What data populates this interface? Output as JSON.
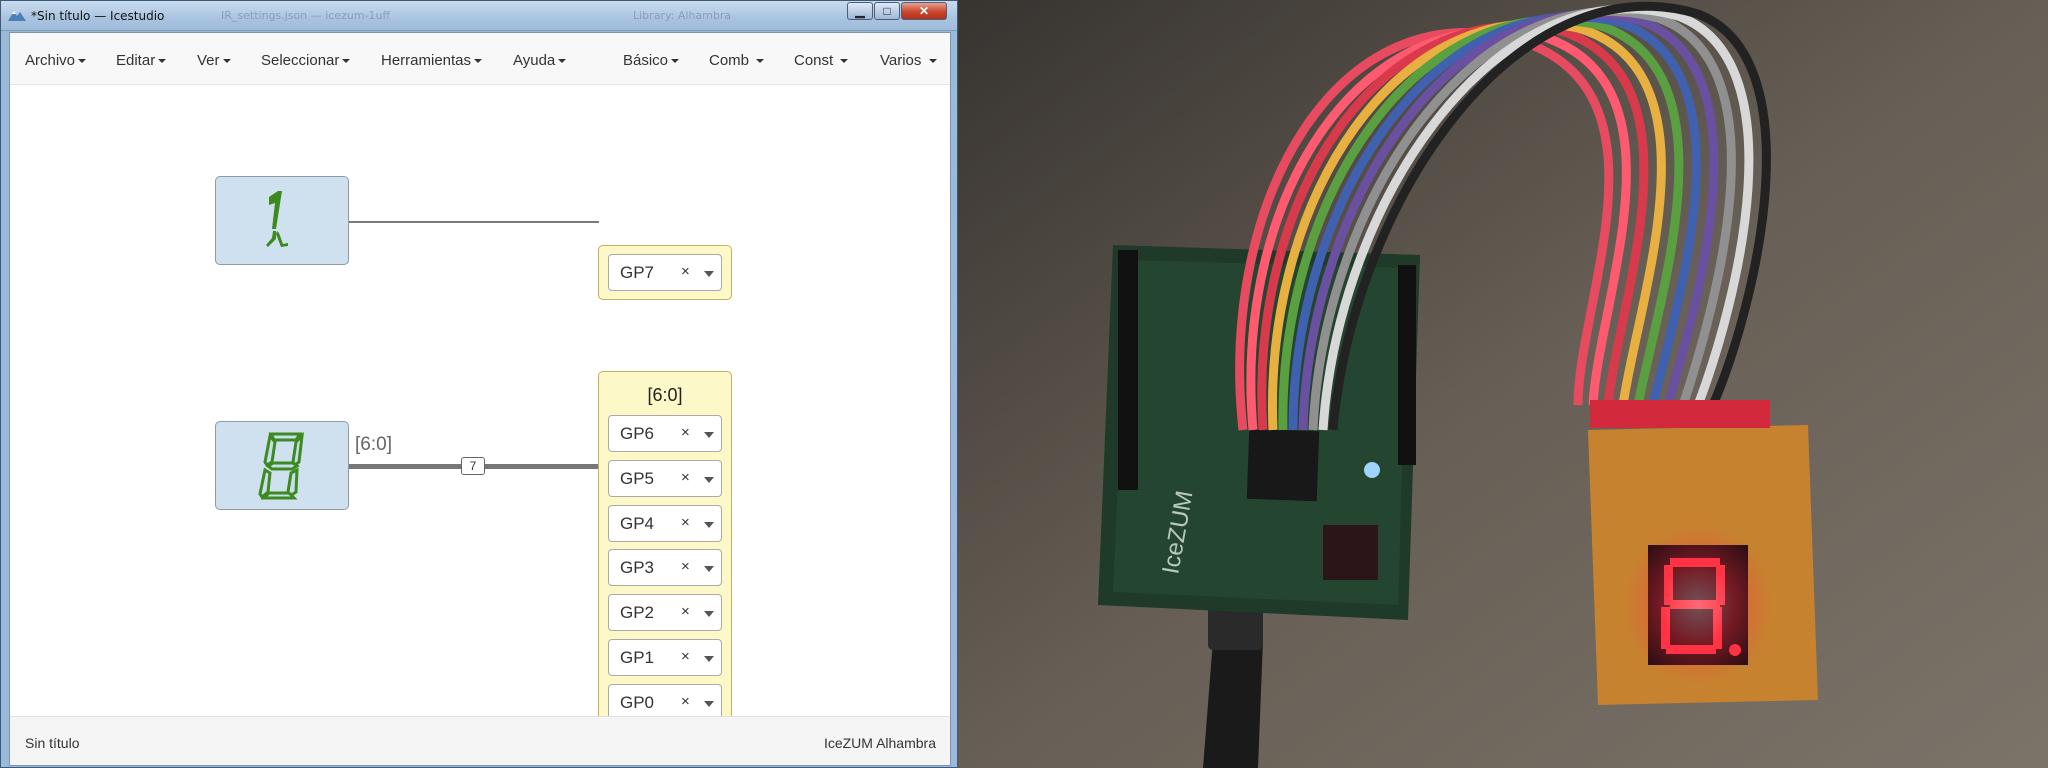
{
  "window": {
    "title": "*Sin título — Icestudio",
    "background_tab_1": "IR_settings.json — icezum-1uff",
    "background_tab_2": "Library: Alhambra",
    "controls": {
      "minimize": "▁",
      "maximize": "□",
      "close": "✕"
    }
  },
  "menubar": {
    "items": [
      "Archivo",
      "Editar",
      "Ver",
      "Seleccionar",
      "Herramientas",
      "Ayuda",
      "Básico",
      "Comb",
      "Const",
      "Varios"
    ]
  },
  "canvas": {
    "display_top": {
      "digit": "1",
      "digit_color": "#3d8a1e"
    },
    "display_bottom": {
      "digit": "8",
      "digit_color": "#3d8a1e"
    },
    "bus": {
      "label": "[6:0]",
      "width": "7"
    },
    "output_single": {
      "pin": "GP7",
      "clear": "×"
    },
    "output_bus": {
      "title": "[6:0]",
      "pins": [
        "GP6",
        "GP5",
        "GP4",
        "GP3",
        "GP2",
        "GP1",
        "GP0"
      ],
      "clear": "×"
    },
    "colors": {
      "display_bg": "#cfe0ee",
      "io_bg": "#fcf8c8",
      "io_border": "#c2b25f"
    }
  },
  "statusbar": {
    "filename": "Sin título",
    "board": "IceZUM Alhambra"
  },
  "photo": {
    "board_silkscreen": "IceZUM",
    "seven_segment_shown": "8",
    "segment_color": "#ff3344"
  }
}
